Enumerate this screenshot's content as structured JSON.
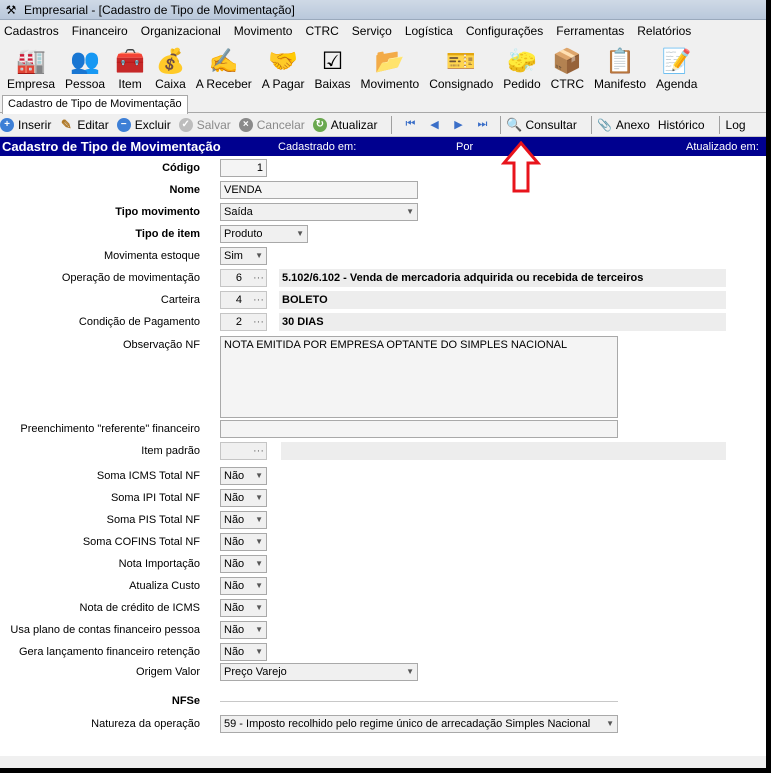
{
  "window": {
    "title": "Empresarial - [Cadastro de Tipo de Movimentação]"
  },
  "menu": [
    "Cadastros",
    "Financeiro",
    "Organizacional",
    "Movimento",
    "CTRC",
    "Serviço",
    "Logística",
    "Configurações",
    "Ferramentas",
    "Relatórios"
  ],
  "toolbar": [
    {
      "label": "Empresa",
      "icon": "building-icon",
      "glyph": "🏭"
    },
    {
      "label": "Pessoa",
      "icon": "people-icon",
      "glyph": "👥"
    },
    {
      "label": "Item",
      "icon": "items-icon",
      "glyph": "🧰"
    },
    {
      "label": "Caixa",
      "icon": "money-bag-icon",
      "glyph": "💰"
    },
    {
      "label": "A Receber",
      "icon": "receive-icon",
      "glyph": "✍"
    },
    {
      "label": "A Pagar",
      "icon": "pay-icon",
      "glyph": "🤝"
    },
    {
      "label": "Baixas",
      "icon": "checklist-icon",
      "glyph": "☑"
    },
    {
      "label": "Movimento",
      "icon": "folder-icon",
      "glyph": "📂"
    },
    {
      "label": "Consignado",
      "icon": "ticket-icon",
      "glyph": "🎫"
    },
    {
      "label": "Pedido",
      "icon": "eraser-icon",
      "glyph": "🧽"
    },
    {
      "label": "CTRC",
      "icon": "box-icon",
      "glyph": "📦"
    },
    {
      "label": "Manifesto",
      "icon": "clipboard-icon",
      "glyph": "📋"
    },
    {
      "label": "Agenda",
      "icon": "calendar-icon",
      "glyph": "📝"
    }
  ],
  "tab": {
    "label": "Cadastro de Tipo de Movimentação"
  },
  "actions": {
    "inserir": "Inserir",
    "editar": "Editar",
    "excluir": "Excluir",
    "salvar": "Salvar",
    "cancelar": "Cancelar",
    "atualizar": "Atualizar",
    "consultar": "Consultar",
    "anexo": "Anexo",
    "historico": "Histórico",
    "log": "Log"
  },
  "header": {
    "title": "Cadastro de Tipo de Movimentação",
    "cadastrado": "Cadastrado em:",
    "por": "Por",
    "atualizado": "Atualizado em:"
  },
  "form": {
    "codigo_label": "Código",
    "codigo": "1",
    "nome_label": "Nome",
    "nome": "VENDA",
    "tipo_mov_label": "Tipo movimento",
    "tipo_mov": "Saída",
    "tipo_item_label": "Tipo de item",
    "tipo_item": "Produto",
    "mov_estoque_label": "Movimenta estoque",
    "mov_estoque": "Sim",
    "operacao_label": "Operação de movimentação",
    "operacao_code": "6",
    "operacao_desc": "5.102/6.102 - Venda de mercadoria adquirida ou recebida de terceiros",
    "carteira_label": "Carteira",
    "carteira_code": "4",
    "carteira_desc": "BOLETO",
    "condicao_label": "Condição de Pagamento",
    "condicao_code": "2",
    "condicao_desc": "30 DIAS",
    "obs_label": "Observação NF",
    "obs": "NOTA EMITIDA POR EMPRESA OPTANTE DO SIMPLES NACIONAL",
    "preench_label": "Preenchimento \"referente\" financeiro",
    "preench": "",
    "item_padrao_label": "Item padrão",
    "soma_icms_label": "Soma ICMS Total NF",
    "soma_icms": "Não",
    "soma_ipi_label": "Soma IPI Total NF",
    "soma_ipi": "Não",
    "soma_pis_label": "Soma PIS Total NF",
    "soma_pis": "Não",
    "soma_cofins_label": "Soma COFINS Total NF",
    "soma_cofins": "Não",
    "nota_imp_label": "Nota Importação",
    "nota_imp": "Não",
    "atualiza_custo_label": "Atualiza Custo",
    "atualiza_custo": "Não",
    "nota_credito_label": "Nota de crédito de ICMS",
    "nota_credito": "Não",
    "usa_plano_label": "Usa plano de contas financeiro pessoa",
    "usa_plano": "Não",
    "gera_lanc_label": "Gera lançamento financeiro retenção",
    "gera_lanc": "Não",
    "origem_label": "Origem Valor",
    "origem": "Preço Varejo",
    "nfse_label": "NFSe",
    "natureza_label": "Natureza da operação",
    "natureza": "59 - Imposto recolhido pelo regime único de arrecadação Simples Nacional"
  },
  "colors": {
    "header_bg": "#00008f",
    "arrow": "#e8141c"
  }
}
